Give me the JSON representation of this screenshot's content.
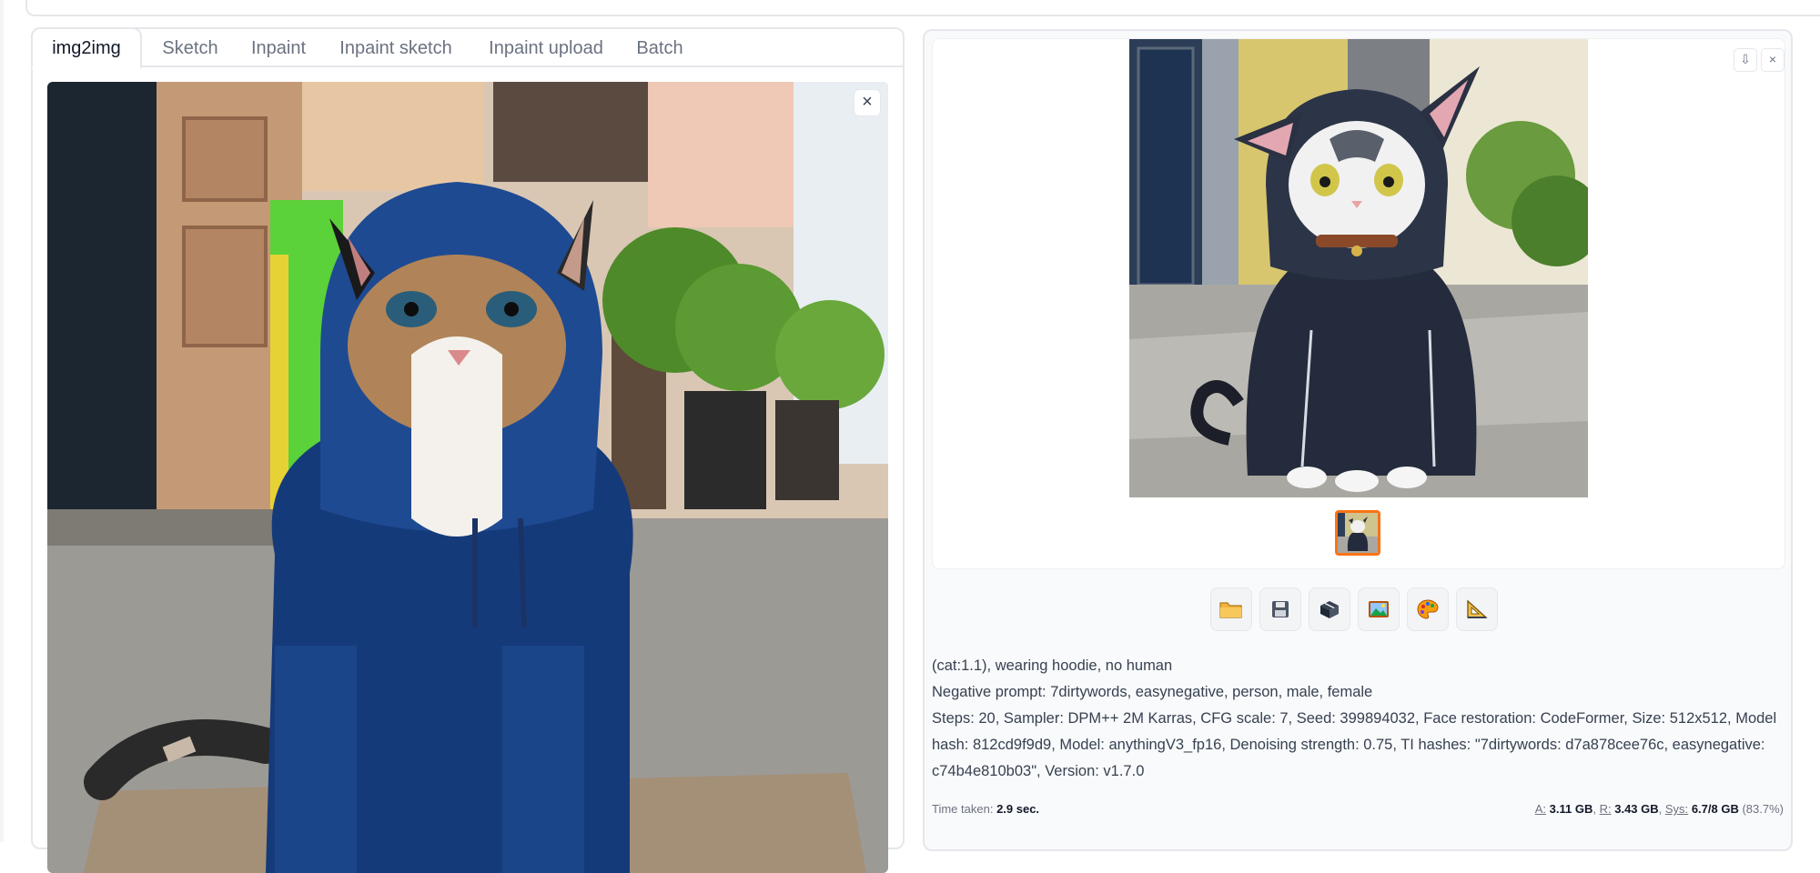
{
  "tabs": [
    {
      "label": "img2img",
      "active": true
    },
    {
      "label": "Sketch",
      "active": false
    },
    {
      "label": "Inpaint",
      "active": false
    },
    {
      "label": "Inpaint sketch",
      "active": false
    },
    {
      "label": "Inpaint upload",
      "active": false
    },
    {
      "label": "Batch",
      "active": false
    }
  ],
  "input_image": {
    "close_label": "×",
    "icon": "close-icon"
  },
  "output": {
    "download_label": "⇩",
    "close_label": "×",
    "toolbar": [
      {
        "name": "open-folder-button",
        "icon": "folder-icon"
      },
      {
        "name": "save-button",
        "icon": "save-icon"
      },
      {
        "name": "zip-button",
        "icon": "package-icon"
      },
      {
        "name": "send-to-img2img-button",
        "icon": "image-icon"
      },
      {
        "name": "send-to-inpaint-button",
        "icon": "palette-icon"
      },
      {
        "name": "send-to-extras-button",
        "icon": "triangle-ruler-icon"
      }
    ],
    "prompt": "(cat:1.1), wearing hoodie, no human",
    "negative_prompt": "Negative prompt: 7dirtywords, easynegative, person, male, female",
    "params_line1": "Steps: 20, Sampler: DPM++ 2M Karras, CFG scale: 7, Seed: 399894032, Face restoration: CodeFormer, Size: 512x512, Model",
    "params_line2": "hash: 812cd9f9d9, Model: anythingV3_fp16, Denoising strength: 0.75, TI hashes: \"7dirtywords: d7a878cee76c, easynegative:",
    "params_line3": "c74b4e810b03\", Version: v1.7.0",
    "time_label": "Time taken:",
    "time_value": "2.9 sec.",
    "mem_a_label": "A:",
    "mem_a_value": "3.11 GB",
    "mem_r_label": "R:",
    "mem_r_value": "3.43 GB",
    "mem_sys_label": "Sys:",
    "mem_sys_value": "6.7/8 GB",
    "mem_pct": "(83.7%)"
  },
  "colors": {
    "accent": "#f97316",
    "border": "#e5e7eb"
  }
}
